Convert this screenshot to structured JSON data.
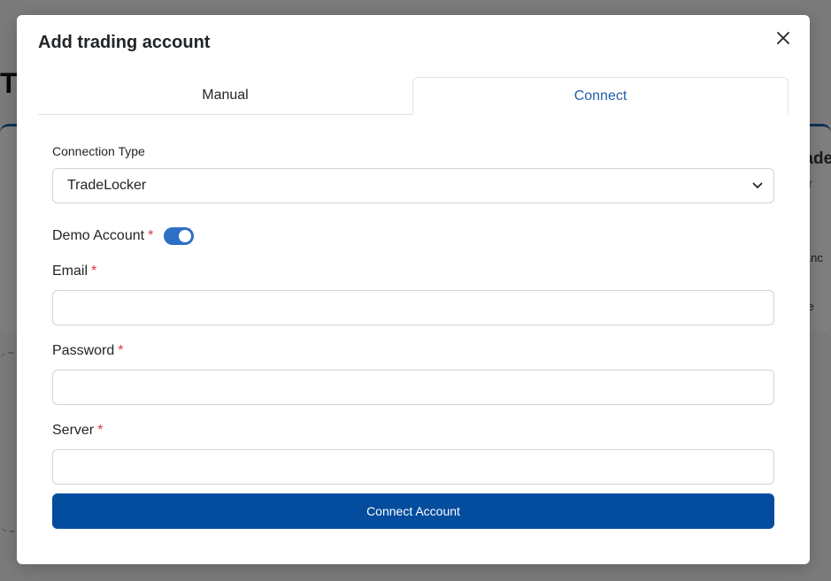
{
  "background": {
    "title_fragment": "Tr",
    "right_fragments": [
      "rade",
      "er",
      "lanc",
      "ce"
    ]
  },
  "modal": {
    "title": "Add trading account",
    "close_icon": "close-icon",
    "tabs": [
      {
        "label": "Manual",
        "active": false
      },
      {
        "label": "Connect",
        "active": true
      }
    ],
    "connection_type": {
      "label": "Connection Type",
      "value": "TradeLocker",
      "icon": "chevron-down-icon"
    },
    "demo_account": {
      "label": "Demo Account",
      "required_mark": "*",
      "enabled": true
    },
    "fields": {
      "email": {
        "label": "Email",
        "required_mark": "*",
        "value": ""
      },
      "password": {
        "label": "Password",
        "required_mark": "*",
        "value": ""
      },
      "server": {
        "label": "Server",
        "required_mark": "*",
        "value": ""
      }
    },
    "submit_label": "Connect Account"
  },
  "colors": {
    "primary": "#044c9e",
    "toggle_on": "#2f6fc6",
    "active_tab_text": "#1f5fa8",
    "required": "#dc3545"
  }
}
